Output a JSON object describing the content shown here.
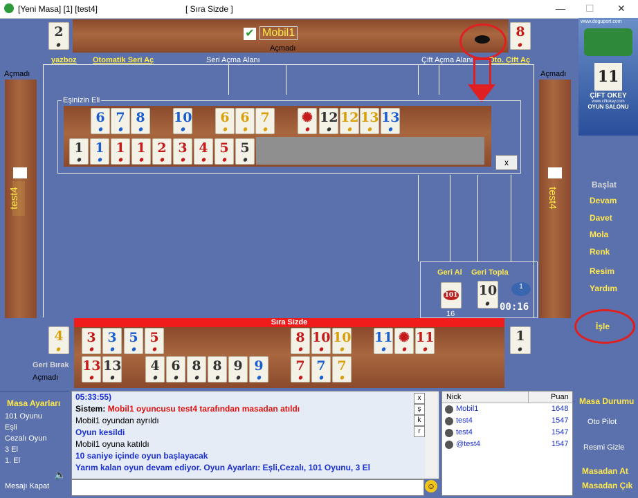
{
  "window": {
    "title": "[Yeni Masa] [1] [test4]",
    "center_title": "[ Sıra Sizde ]",
    "minimize": "—",
    "maximize": "☐",
    "close": "✕"
  },
  "top_player": {
    "name": "Mobil1",
    "status": "Açmadı",
    "indicator_left": "2",
    "indicator_right": "8"
  },
  "left_player": {
    "name": "test4",
    "status": "Açmadı"
  },
  "right_player": {
    "name": "test4",
    "status": "Açmadı"
  },
  "labels": {
    "yazboz": "yazboz",
    "otomatik": "Otomatik Seri Aç",
    "seri_acma": "Seri Açma Alanı",
    "cift_acma": "Çift Açma Alanı",
    "oto_cift": "Oto. Çift Aç",
    "partner_hand": "Eşinizin Eli",
    "close_x": "x",
    "geri_al": "Geri Al",
    "geri_topla": "Geri Topla",
    "geri_al_count": "16",
    "deck_count": "1",
    "timer": "00:16",
    "sira_sizde": "Sıra Sizde",
    "geri_birak": "Geri Bırak",
    "bottom_status": "Açmadı",
    "bottom_left_ind": "4",
    "bottom_right_ind": "1"
  },
  "logo": {
    "site": "www.doguport.com",
    "title": "ÇİFT OKEY",
    "subtitle": "OYUN SALONU",
    "site2": "www.ciftokey.com"
  },
  "side_menu": [
    "Başlat",
    "Devam",
    "Davet",
    "Mola",
    "Renk",
    "Resim",
    "Yardım",
    "İşle"
  ],
  "partner_row1": [
    {
      "v": "6",
      "c": "blue"
    },
    {
      "v": "7",
      "c": "blue"
    },
    {
      "v": "8",
      "c": "blue"
    },
    {
      "v": "10",
      "c": "blue"
    },
    {
      "v": "6",
      "c": "yellow"
    },
    {
      "v": "6",
      "c": "yellow"
    },
    {
      "v": "7",
      "c": "yellow"
    },
    {
      "v": "✺",
      "c": "red"
    },
    {
      "v": "12",
      "c": "black"
    },
    {
      "v": "12",
      "c": "yellow"
    },
    {
      "v": "13",
      "c": "yellow"
    },
    {
      "v": "13",
      "c": "blue"
    }
  ],
  "partner_row2": [
    {
      "v": "1",
      "c": "black"
    },
    {
      "v": "1",
      "c": "blue"
    },
    {
      "v": "1",
      "c": "red"
    },
    {
      "v": "1",
      "c": "red"
    },
    {
      "v": "2",
      "c": "red"
    },
    {
      "v": "3",
      "c": "red"
    },
    {
      "v": "4",
      "c": "red"
    },
    {
      "v": "5",
      "c": "red"
    },
    {
      "v": "5",
      "c": "black"
    }
  ],
  "my_row1": [
    {
      "v": "3",
      "c": "red"
    },
    {
      "v": "3",
      "c": "blue"
    },
    {
      "v": "5",
      "c": "blue"
    },
    {
      "v": "5",
      "c": "red"
    },
    {
      "v": "8",
      "c": "red"
    },
    {
      "v": "10",
      "c": "red"
    },
    {
      "v": "10",
      "c": "yellow"
    },
    {
      "v": "11",
      "c": "blue"
    },
    {
      "v": "✺",
      "c": "red"
    },
    {
      "v": "11",
      "c": "red"
    }
  ],
  "my_row2": [
    {
      "v": "13",
      "c": "red"
    },
    {
      "v": "13",
      "c": "black"
    },
    {
      "v": "4",
      "c": "black"
    },
    {
      "v": "6",
      "c": "black"
    },
    {
      "v": "8",
      "c": "black"
    },
    {
      "v": "8",
      "c": "black"
    },
    {
      "v": "9",
      "c": "black"
    },
    {
      "v": "9",
      "c": "blue"
    },
    {
      "v": "7",
      "c": "red"
    },
    {
      "v": "7",
      "c": "blue"
    },
    {
      "v": "7",
      "c": "yellow"
    }
  ],
  "geri_al_tile": "101",
  "geri_topla_tile": "10",
  "settings": {
    "title": "Masa Ayarları",
    "items": [
      "101 Oyunu",
      "Eşli",
      "Cezalı Oyun",
      "3 El",
      "1. El"
    ],
    "close_msg": "Mesajı Kapat"
  },
  "chat": [
    {
      "text": "05:33:55)",
      "color": "#1a2fd1"
    },
    {
      "text": "Sistem: ",
      "color": "#000",
      "extra": "Mobil1 oyuncusu test4 tarafından masadan atıldı",
      "extra_color": "#e01010"
    },
    {
      "text": "Mobil1 oyundan ayrıldı",
      "color": "#000",
      "normal": true
    },
    {
      "text": "Oyun kesildi",
      "color": "#1a2fd1"
    },
    {
      "text": "Mobil1 oyuna katıldı",
      "color": "#000",
      "normal": true
    },
    {
      "text": "10 saniye içinde oyun başlayacak",
      "color": "#1a2fd1"
    },
    {
      "text": "Yarım kalan oyun devam ediyor. Oyun Ayarları:  Eşli,Cezalı, 101 Oyunu, 3 El",
      "color": "#1a2fd1"
    }
  ],
  "chat_buttons": [
    "x",
    "ş",
    "k",
    "r"
  ],
  "players_table": {
    "headers": [
      "Nick",
      "Puan"
    ],
    "rows": [
      [
        "Mobil1",
        "1648"
      ],
      [
        "test4",
        "1547"
      ],
      [
        "test4",
        "1547"
      ],
      [
        "@test4",
        "1547"
      ]
    ]
  },
  "table_status": {
    "title": "Masa Durumu",
    "items": [
      "Oto Pilot",
      "Resmi Gizle"
    ],
    "leave": "Masadan At",
    "exit": "Masadan Çık"
  }
}
